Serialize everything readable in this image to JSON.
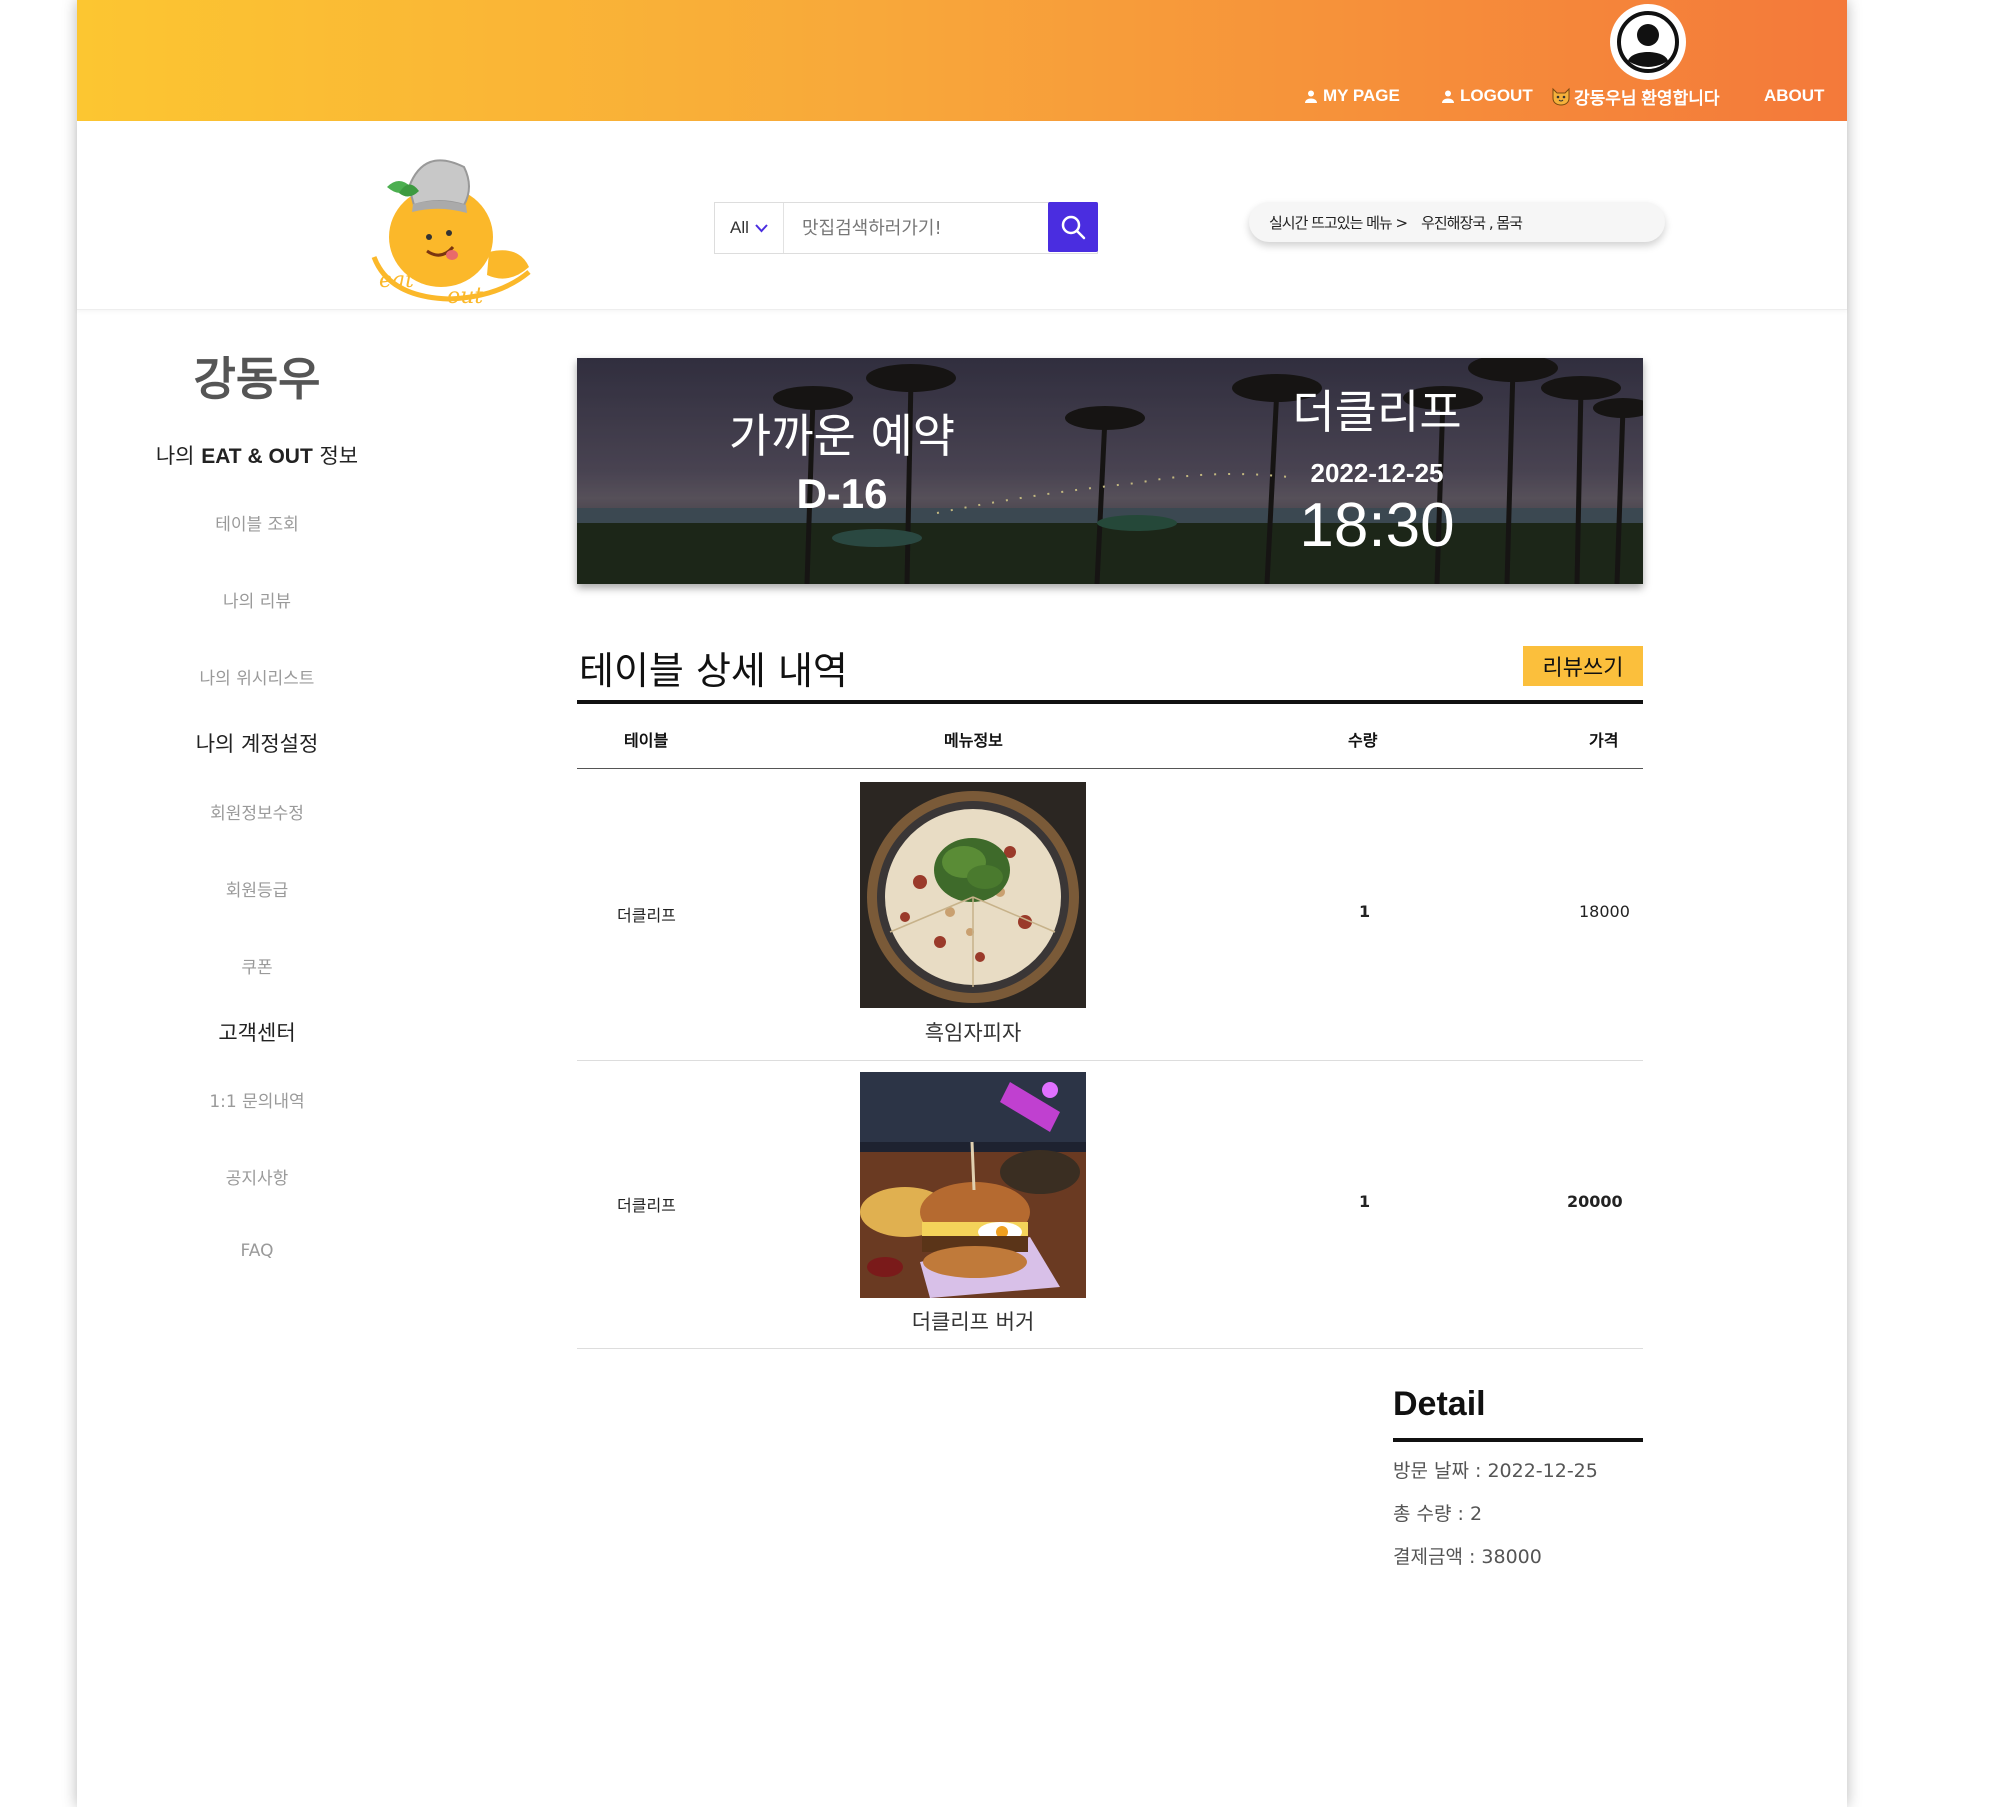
{
  "topbar": {
    "my_page": "MY PAGE",
    "logout": "LOGOUT",
    "welcome": "강동우님 환영합니다",
    "about": "ABOUT"
  },
  "search": {
    "category": "All",
    "placeholder": "맛집검색하러가기!"
  },
  "trending": {
    "label": "실시간 뜨고있는 메뉴 >",
    "items": "우진해장국 , 몸국"
  },
  "sidebar": {
    "user_name": "강동우",
    "section_info_prefix": "나의",
    "section_info_brand": "EAT & OUT",
    "section_info_suffix": "정보",
    "info_items": [
      "테이블 조회",
      "나의 리뷰",
      "나의 위시리스트"
    ],
    "section_account": "나의 계정설정",
    "account_items": [
      "회원정보수정",
      "회원등급",
      "쿠폰"
    ],
    "section_support": "고객센터",
    "support_items": [
      "1:1 문의내역",
      "공지사항",
      "FAQ"
    ]
  },
  "banner": {
    "title": "가까운 예약",
    "dday": "D-16",
    "restaurant": "더클리프",
    "date": "2022-12-25",
    "time": "18:30"
  },
  "table_section": {
    "title": "테이블 상세 내역",
    "review_button": "리뷰쓰기",
    "headers": [
      "테이블",
      "메뉴정보",
      "수량",
      "가격"
    ],
    "rows": [
      {
        "table": "더클리프",
        "menu": "흑임자피자",
        "qty": "1",
        "price": "18000"
      },
      {
        "table": "더클리프",
        "menu": "더클리프 버거",
        "qty": "1",
        "price": "20000"
      }
    ]
  },
  "detail": {
    "title": "Detail",
    "visit_date": "방문 날짜 : 2022-12-25",
    "total_qty": "총 수량 : 2",
    "total_price": "결제금액 : 38000"
  },
  "colors": {
    "topbar_start": "#fcc631",
    "topbar_end": "#f4793a",
    "search_button": "#4a2de0",
    "review_button": "#fbbf3c"
  }
}
